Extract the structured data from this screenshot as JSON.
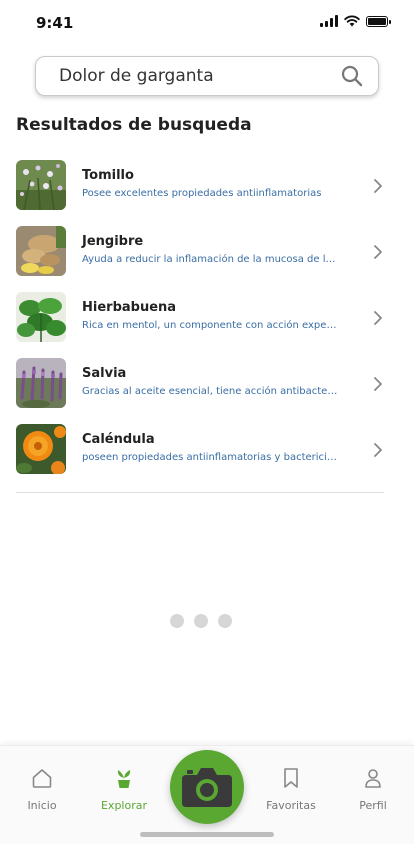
{
  "status_bar": {
    "time": "9:41"
  },
  "search": {
    "value": "Dolor de garganta"
  },
  "results": {
    "title": "Resultados de busqueda",
    "items": [
      {
        "name": "Tomillo",
        "description": "Posee excelentes propiedades antiinflamatorias"
      },
      {
        "name": "Jengibre",
        "description": "Ayuda a reducir la inflamación de la mucosa de la garganta"
      },
      {
        "name": "Hierbabuena",
        "description": "Rica en mentol, un componente con acción expectorante"
      },
      {
        "name": "Salvia",
        "description": "Gracias al aceite esencial, tiene acción antibacteriana"
      },
      {
        "name": "Caléndula",
        "description": "poseen propiedades antiinflamatorias y bactericidas"
      }
    ]
  },
  "tab_bar": {
    "tabs": [
      {
        "label": "Inicio",
        "icon": "home-icon"
      },
      {
        "label": "Explorar",
        "icon": "sprout-icon",
        "active": true
      },
      {
        "label": "Favoritas",
        "icon": "bookmark-icon"
      },
      {
        "label": "Perfil",
        "icon": "person-icon"
      }
    ],
    "center_action": {
      "icon": "camera-icon"
    }
  },
  "colors": {
    "accent": "#5aa832",
    "description_text": "#3a6ea5"
  }
}
